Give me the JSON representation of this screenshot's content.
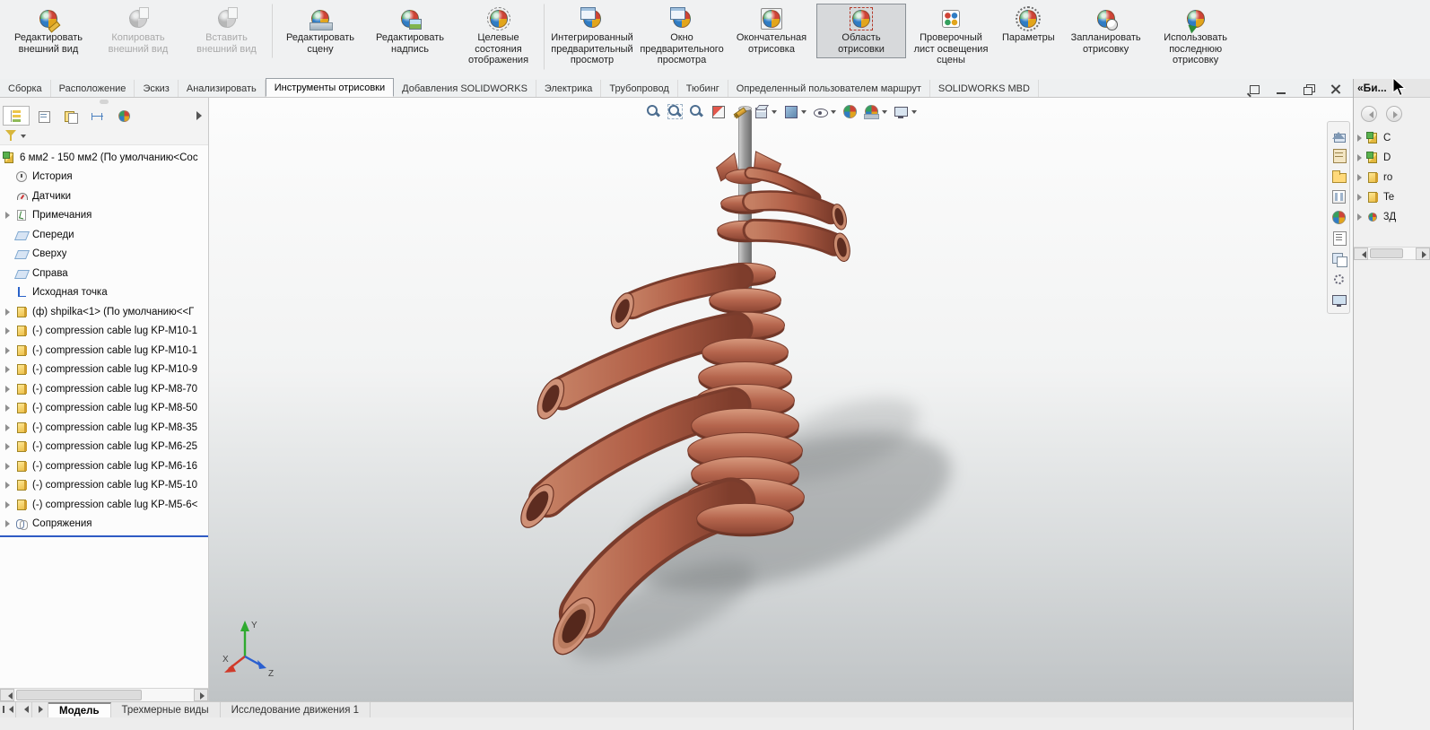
{
  "colors": {
    "copper": "#b5654d",
    "selection_bar": "#2f5bc4",
    "viewport_top": "#fcfcfc",
    "viewport_bottom": "#bfc3c5",
    "ribbon_bg": "#f0f1f2"
  },
  "ribbon": {
    "buttons": [
      {
        "label": "Редактировать внешний вид",
        "icon": "edit-appearance-icon"
      },
      {
        "label": "Копировать внешний вид",
        "icon": "copy-appearance-icon",
        "disabled": true
      },
      {
        "label": "Вставить внешний вид",
        "icon": "paste-appearance-icon",
        "disabled": true,
        "sep_after": true
      },
      {
        "label": "Редактировать сцену",
        "icon": "edit-scene-icon"
      },
      {
        "label": "Редактировать надпись",
        "icon": "edit-decal-icon"
      },
      {
        "label": "Целевые состояния отображения",
        "icon": "display-states-icon",
        "sep_after": true
      },
      {
        "label": "Интегрированный предварительный просмотр",
        "icon": "integrated-preview-icon"
      },
      {
        "label": "Окно предварительного просмотра",
        "icon": "preview-window-icon"
      },
      {
        "label": "Окончательная отрисовка",
        "icon": "final-render-icon"
      },
      {
        "label": "Область отрисовки",
        "icon": "render-region-icon",
        "selected": true
      },
      {
        "label": "Проверочный лист освещения сцены",
        "icon": "proof-sheet-icon"
      },
      {
        "label": "Параметры",
        "icon": "options-icon"
      },
      {
        "label": "Запланировать отрисовку",
        "icon": "schedule-render-icon"
      },
      {
        "label": "Использовать последнюю отрисовку",
        "icon": "recall-render-icon"
      }
    ]
  },
  "command_tabs": {
    "tabs": [
      {
        "label": "Сборка"
      },
      {
        "label": "Расположение"
      },
      {
        "label": "Эскиз"
      },
      {
        "label": "Анализировать"
      },
      {
        "label": "Инструменты отрисовки",
        "active": true
      },
      {
        "label": "Добавления SOLIDWORKS"
      },
      {
        "label": "Электрика"
      },
      {
        "label": "Трубопровод"
      },
      {
        "label": "Тюбинг"
      },
      {
        "label": "Определенный пользователем маршрут"
      },
      {
        "label": "SOLIDWORKS MBD"
      }
    ],
    "window_controls": [
      {
        "name": "float-window-icon"
      },
      {
        "name": "minimize-window-icon"
      },
      {
        "name": "restore-window-icon"
      },
      {
        "name": "close-window-icon"
      }
    ]
  },
  "feature_panel": {
    "tabs": [
      {
        "name": "featuremanager-tab-icon",
        "active": true
      },
      {
        "name": "propertymanager-tab-icon"
      },
      {
        "name": "configurationmanager-tab-icon"
      },
      {
        "name": "dimxpertmanager-tab-icon"
      },
      {
        "name": "displaymanager-tab-icon"
      }
    ],
    "tree": {
      "items": [
        {
          "label": "6 мм2 - 150 мм2  (По умолчанию<Сос",
          "icon": "assembly-icon"
        },
        {
          "label": "История",
          "icon": "history-icon",
          "child": true
        },
        {
          "label": "Датчики",
          "icon": "sensors-icon",
          "child": true
        },
        {
          "label": "Примечания",
          "icon": "annotations-icon",
          "child": true,
          "expand": true
        },
        {
          "label": "Спереди",
          "icon": "plane-icon",
          "child": true
        },
        {
          "label": "Сверху",
          "icon": "plane-icon",
          "child": true
        },
        {
          "label": "Справа",
          "icon": "plane-icon",
          "child": true
        },
        {
          "label": "Исходная точка",
          "icon": "origin-icon",
          "child": true
        },
        {
          "label": "(ф) shpilka<1> (По умолчанию<<Г",
          "icon": "part-icon",
          "child": true,
          "expand": true
        },
        {
          "label": "(-) compression cable lug KP-M10-1",
          "icon": "part-icon",
          "child": true,
          "expand": true
        },
        {
          "label": "(-) compression cable lug KP-M10-1",
          "icon": "part-icon",
          "child": true,
          "expand": true
        },
        {
          "label": "(-) compression cable lug KP-M10-9",
          "icon": "part-icon",
          "child": true,
          "expand": true
        },
        {
          "label": "(-) compression cable lug KP-M8-70",
          "icon": "part-icon",
          "child": true,
          "expand": true
        },
        {
          "label": "(-) compression cable lug KP-M8-50",
          "icon": "part-icon",
          "child": true,
          "expand": true
        },
        {
          "label": "(-) compression cable lug KP-M8-35",
          "icon": "part-icon",
          "child": true,
          "expand": true
        },
        {
          "label": "(-) compression cable lug KP-M6-25",
          "icon": "part-icon",
          "child": true,
          "expand": true
        },
        {
          "label": "(-) compression cable lug KP-M6-16",
          "icon": "part-icon",
          "child": true,
          "expand": true
        },
        {
          "label": "(-) compression cable lug KP-M5-10",
          "icon": "part-icon",
          "child": true,
          "expand": true
        },
        {
          "label": "(-) compression cable lug KP-M5-6<",
          "icon": "part-icon",
          "child": true,
          "expand": true
        },
        {
          "label": "Сопряжения",
          "icon": "mates-icon",
          "child": true,
          "expand": true
        }
      ]
    }
  },
  "viewport": {
    "toolbar": {
      "tools": [
        {
          "name": "zoom-to-fit-icon"
        },
        {
          "name": "zoom-to-area-icon"
        },
        {
          "name": "previous-view-icon"
        },
        {
          "name": "section-view-icon"
        },
        {
          "name": "edit-appearance-pencil-icon"
        },
        {
          "name": "view-orientation-icon",
          "dd": true
        },
        {
          "name": "display-style-icon",
          "dd": true
        },
        {
          "name": "hide-show-items-icon",
          "dd": true
        },
        {
          "name": "appearance-ball-icon"
        },
        {
          "name": "apply-scene-icon",
          "dd": true
        },
        {
          "name": "view-settings-icon",
          "dd": true
        }
      ]
    },
    "triad": {
      "x_label": "X",
      "y_label": "Y",
      "z_label": "Z"
    }
  },
  "task_pane": {
    "tools": [
      {
        "name": "home-icon"
      },
      {
        "name": "design-library-icon"
      },
      {
        "name": "file-explorer-icon"
      },
      {
        "name": "view-palette-icon"
      },
      {
        "name": "appearances-icon"
      },
      {
        "name": "custom-properties-icon"
      },
      {
        "name": "panes-icon"
      },
      {
        "name": "settings-gear-icon"
      },
      {
        "name": "screen-icon"
      }
    ]
  },
  "right_panel": {
    "title": "«Би...",
    "items": [
      {
        "label": "C",
        "icon": "assembly-icon"
      },
      {
        "label": "D",
        "icon": "assembly-icon"
      },
      {
        "label": "ro",
        "icon": "part-icon"
      },
      {
        "label": "Te",
        "icon": "part-icon"
      },
      {
        "label": "3Д",
        "icon": "appearances-icon"
      }
    ]
  },
  "bottom_bar": {
    "tabs": [
      {
        "label": "Модель",
        "active": true
      },
      {
        "label": "Трехмерные виды"
      },
      {
        "label": "Исследование движения 1"
      }
    ]
  }
}
